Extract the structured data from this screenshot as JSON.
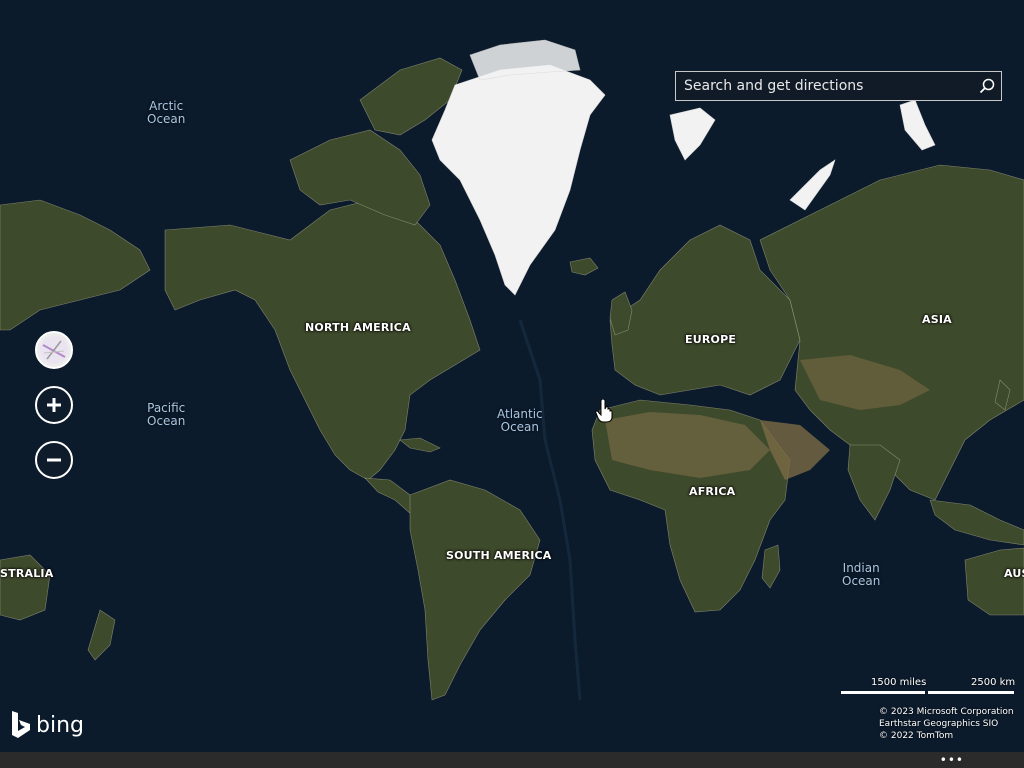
{
  "search": {
    "placeholder": "Search and get directions",
    "icon": "search-icon"
  },
  "controls": {
    "view_icon": "map-style-icon",
    "zoom_in_icon": "plus-icon",
    "zoom_out_icon": "minus-icon"
  },
  "continents": {
    "north_america": "NORTH AMERICA",
    "south_america": "SOUTH AMERICA",
    "europe": "EUROPE",
    "africa": "AFRICA",
    "asia": "ASIA",
    "australia_left": "STRALIA",
    "australia_right": "AUS"
  },
  "oceans": {
    "arctic": "Arctic\nOcean",
    "pacific": "Pacific\nOcean",
    "atlantic": "Atlantic\nOcean",
    "indian": "Indian\nOcean"
  },
  "scale": {
    "miles": "1500 miles",
    "km": "2500 km"
  },
  "copyright": {
    "line1": "© 2023 Microsoft Corporation",
    "line2": "Earthstar Geographics  SIO",
    "line3": "© 2022 TomTom"
  },
  "brand": {
    "name": "bing",
    "icon": "bing-logo-icon"
  },
  "bottom_bar": {
    "more": "•••"
  },
  "colors": {
    "ocean": "#0c1b2c",
    "land": "#3e4a2c",
    "ice": "#f2f2f2",
    "ocean_label": "#a9c6e3"
  }
}
